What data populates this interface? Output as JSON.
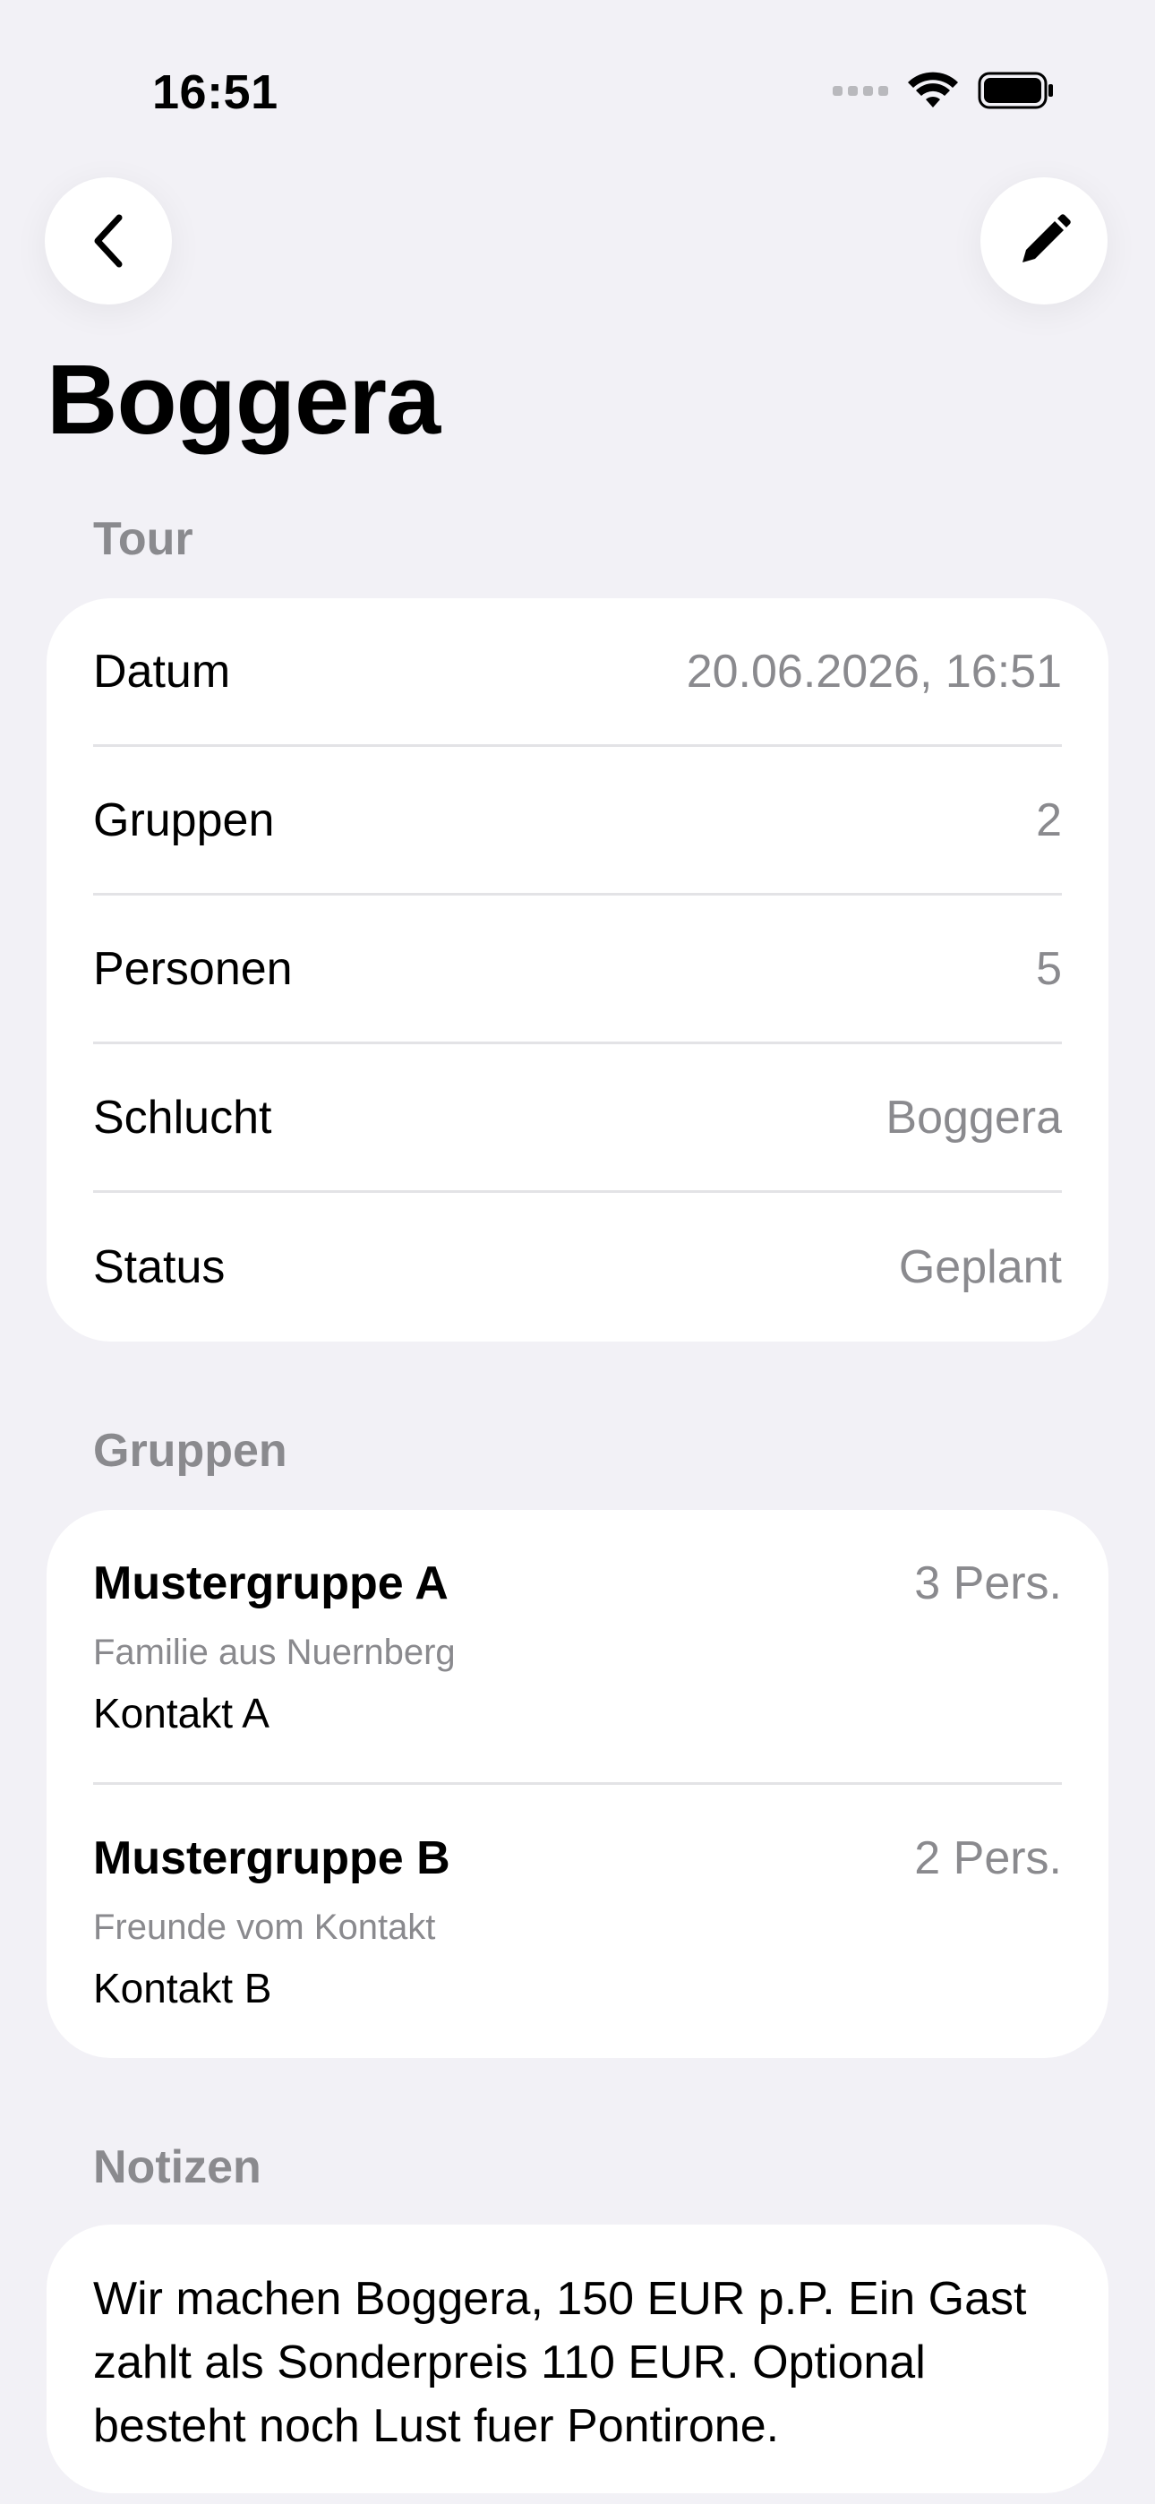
{
  "status_bar": {
    "time": "16:51"
  },
  "nav": {
    "back_icon": "chevron-left-icon",
    "edit_icon": "pencil-icon"
  },
  "title": "Boggera",
  "tour": {
    "header": "Tour",
    "rows": [
      {
        "label": "Datum",
        "value": "20.06.2026, 16:51"
      },
      {
        "label": "Gruppen",
        "value": "2"
      },
      {
        "label": "Personen",
        "value": "5"
      },
      {
        "label": "Schlucht",
        "value": "Boggera"
      },
      {
        "label": "Status",
        "value": "Geplant"
      }
    ]
  },
  "groups": {
    "header": "Gruppen",
    "items": [
      {
        "name": "Mustergruppe A",
        "persons": "3 Pers.",
        "description": "Familie aus Nuernberg",
        "contact": "Kontakt A"
      },
      {
        "name": "Mustergruppe B",
        "persons": "2 Pers.",
        "description": "Freunde vom Kontakt",
        "contact": "Kontakt B"
      }
    ]
  },
  "notes": {
    "header": "Notizen",
    "text": "Wir machen Boggera, 150 EUR p.P. Ein Gast zahlt als Sonderpreis 110 EUR. Optional besteht noch Lust fuer Pontirone."
  },
  "colors": {
    "background": "#f2f1f6",
    "card": "#ffffff",
    "secondary_text": "#8a8a8e",
    "separator": "#e3e3e6"
  }
}
